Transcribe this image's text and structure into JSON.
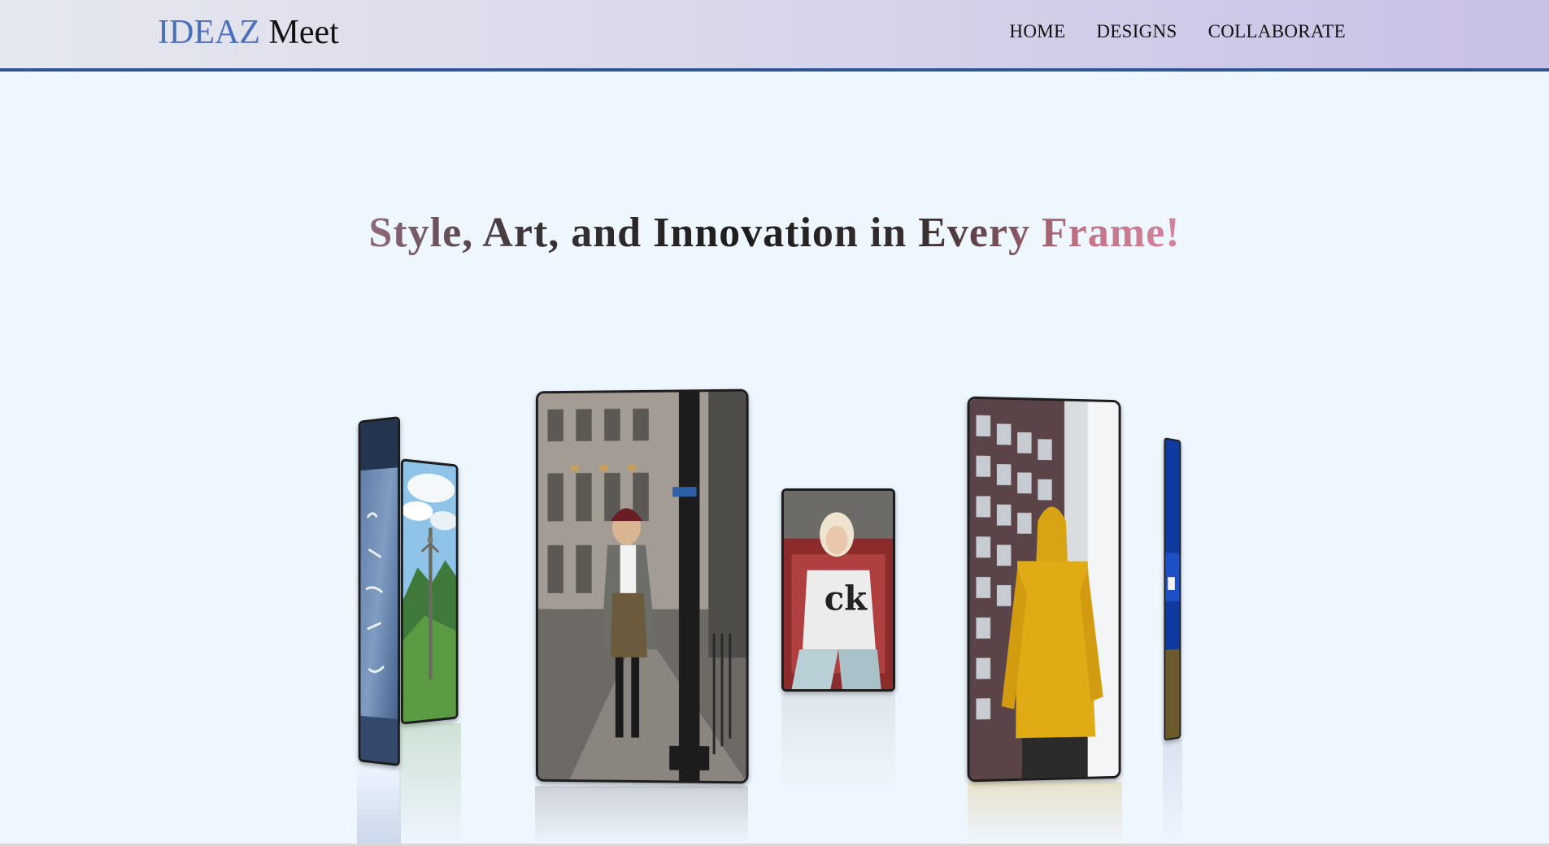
{
  "header": {
    "logo_brand": "IDEAZ",
    "logo_suffix": "Meet",
    "nav": [
      {
        "label": "HOME"
      },
      {
        "label": "DESIGNS"
      },
      {
        "label": "COLLABORATE"
      }
    ]
  },
  "hero": {
    "headline": "Style, Art, and Innovation in Every Frame!"
  },
  "gallery": {
    "photos": [
      {
        "name": "denim-jacket-photo",
        "subject": "denim jacket with handwritten text"
      },
      {
        "name": "mountain-statue-photo",
        "subject": "statue against mountain valley"
      },
      {
        "name": "street-woman-photo",
        "subject": "woman in coat on city street"
      },
      {
        "name": "blonde-woman-photo",
        "subject": "blonde woman in graphic t-shirt"
      },
      {
        "name": "yellow-hoodie-photo",
        "subject": "man in yellow hoodie by building"
      },
      {
        "name": "blue-building-photo",
        "subject": "blue building edge"
      }
    ]
  },
  "colors": {
    "brand_blue": "#4a6fbd",
    "nav_border": "#2f5596",
    "page_bg": "#eef6ff"
  }
}
